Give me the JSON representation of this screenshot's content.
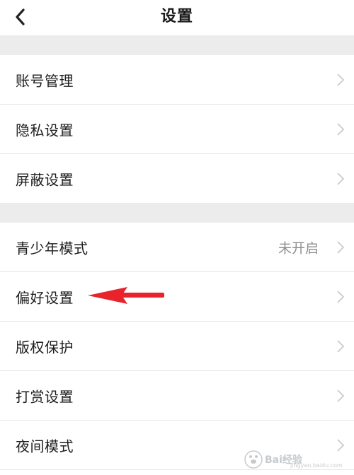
{
  "header": {
    "title": "设置"
  },
  "groups": [
    {
      "items": [
        {
          "label": "账号管理"
        },
        {
          "label": "隐私设置"
        },
        {
          "label": "屏蔽设置"
        }
      ]
    },
    {
      "items": [
        {
          "label": "青少年模式",
          "value": "未开启"
        },
        {
          "label": "偏好设置"
        },
        {
          "label": "版权保护"
        },
        {
          "label": "打赏设置"
        },
        {
          "label": "夜间模式"
        }
      ]
    }
  ],
  "colors": {
    "arrow": "#e8232b",
    "gap": "#ececec",
    "divider": "#e6e6e6",
    "value": "#8e8e8e"
  },
  "annotation": {
    "type": "red-arrow",
    "points_to": "偏好设置"
  },
  "watermark": {
    "text": "Bai经验",
    "sub": "jingyan.baidu.com"
  }
}
